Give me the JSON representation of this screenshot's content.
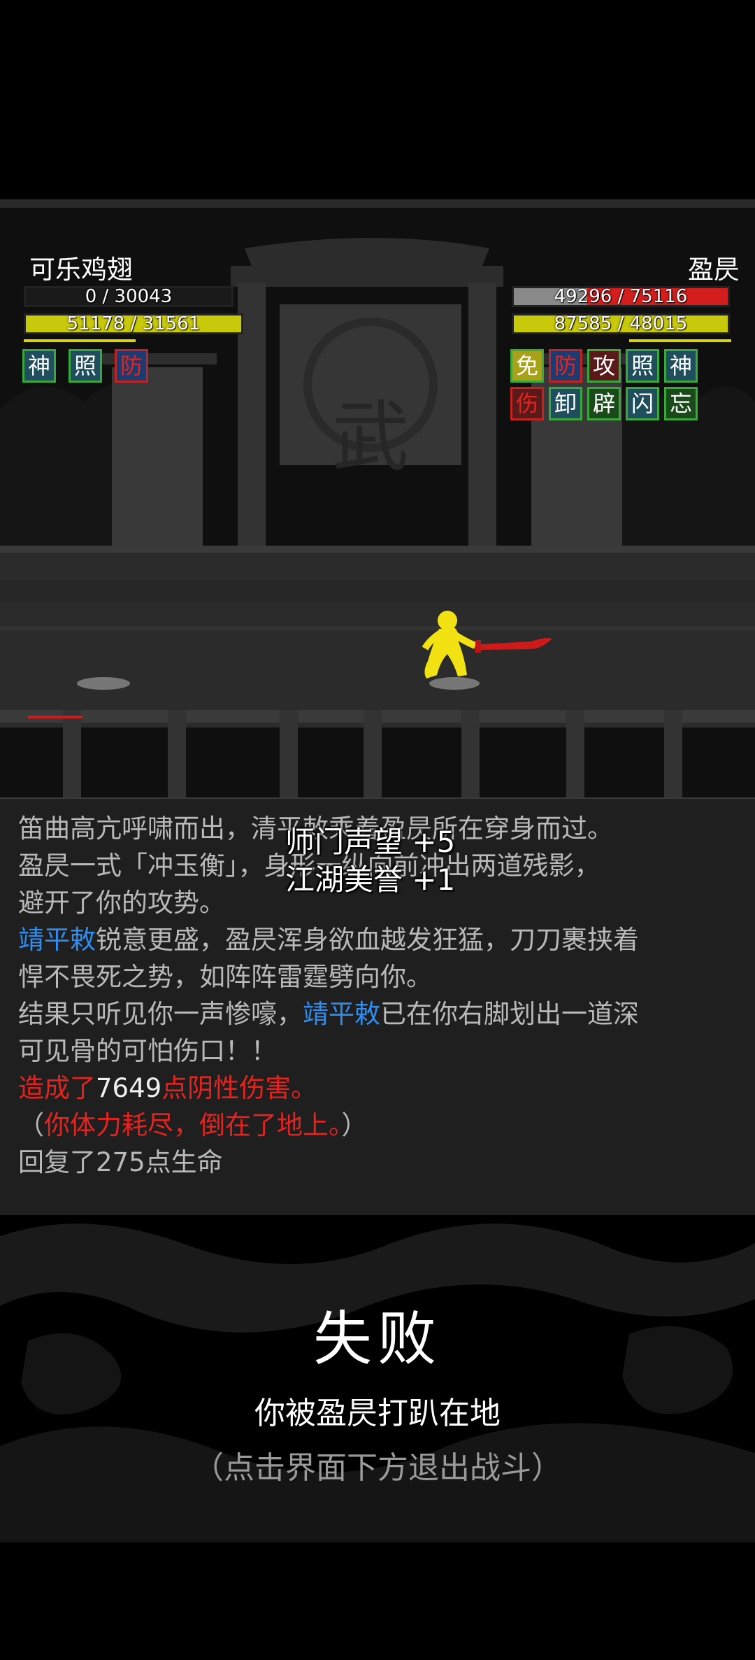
{
  "player": {
    "name": "可乐鸡翅",
    "hp_text": "0 / 30043",
    "hp_fraction": 0.0,
    "energy_text": "51178 / 31561",
    "energy_fraction": 1.0,
    "statuses": [
      "神",
      "照",
      "防"
    ]
  },
  "enemy": {
    "name": "盈昃",
    "hp_text": "49296 / 75116",
    "hp_fraction": 0.656,
    "energy_text": "87585 / 48015",
    "energy_fraction": 1.0,
    "statuses_row1": [
      "免",
      "防",
      "攻",
      "照",
      "神"
    ],
    "statuses_row2": [
      "伤",
      "卸",
      "辟",
      "闪",
      "忘"
    ]
  },
  "scene": {
    "gate_character": "武"
  },
  "rewards": [
    "师门声望 +5",
    "江湖美誉 +1"
  ],
  "log": {
    "l1": "笛曲高亢呼啸而出，清平敕乘着盈昃所在穿身而过。",
    "l2": "盈昃一式「冲玉衡」，身形一纵向前冲出两道残影，",
    "l3": "避开了你的攻势。",
    "l4_name": "靖平敕",
    "l4_rest": "锐意更盛，盈昃浑身欲血越发狂猛，刀刀裹挟着",
    "l5": "悍不畏死之势，如阵阵雷霆劈向你。",
    "l6_a": "结果只听见你一声惨嚎，",
    "l6_name": "靖平敕",
    "l6_b": "已在你右脚划出一道深",
    "l7": "可见骨的可怕伤口！！",
    "l8_a": "造成了",
    "l8_num": "7649",
    "l8_b": "点阴性伤害。",
    "l9_a": "（",
    "l9_red": "你体力耗尽，倒在了地上。",
    "l9_b": "）",
    "l10": "回复了275点生命"
  },
  "result": {
    "title": "失败",
    "subtitle": "你被盈昃打趴在地",
    "hint": "（点击界面下方退出战斗）"
  }
}
